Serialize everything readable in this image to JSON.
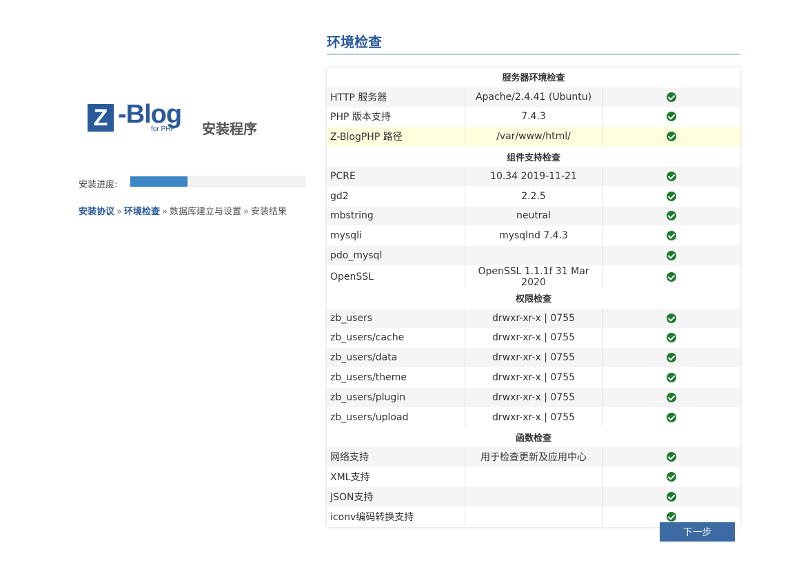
{
  "logo": {
    "z": "Z",
    "word": "-Blog",
    "sub": "for PHP",
    "title": "安装程序"
  },
  "progress": {
    "label": "安装进度:",
    "value": 0.33
  },
  "steps": [
    {
      "label": "安装协议",
      "done": true
    },
    {
      "label": "环境检查",
      "done": true
    },
    {
      "label": "数据库建立与设置",
      "done": false
    },
    {
      "label": "安装结果",
      "done": false
    }
  ],
  "step_separator": "»",
  "page_title": "环境检查",
  "sections": [
    {
      "title": "服务器环境检查",
      "rows": [
        {
          "name": "HTTP 服务器",
          "value": "Apache/2.4.41 (Ubuntu)",
          "status": "ok"
        },
        {
          "name": "PHP 版本支持",
          "value": "7.4.3",
          "status": "ok"
        },
        {
          "name": "Z-BlogPHP 路径",
          "value": "/var/www/html/",
          "status": "ok",
          "highlight": true
        }
      ]
    },
    {
      "title": "组件支持检查",
      "rows": [
        {
          "name": "PCRE",
          "value": "10.34 2019-11-21",
          "status": "ok"
        },
        {
          "name": "gd2",
          "value": "2.2.5",
          "status": "ok"
        },
        {
          "name": "mbstring",
          "value": "neutral",
          "status": "ok"
        },
        {
          "name": "mysqli",
          "value": "mysqlnd 7.4.3",
          "status": "ok"
        },
        {
          "name": "pdo_mysql",
          "value": "",
          "status": "ok"
        },
        {
          "name": "OpenSSL",
          "value": "OpenSSL 1.1.1f 31 Mar 2020",
          "status": "ok"
        }
      ]
    },
    {
      "title": "权限检查",
      "rows": [
        {
          "name": "zb_users",
          "value": "drwxr-xr-x | 0755",
          "status": "ok"
        },
        {
          "name": "zb_users/cache",
          "value": "drwxr-xr-x | 0755",
          "status": "ok"
        },
        {
          "name": "zb_users/data",
          "value": "drwxr-xr-x | 0755",
          "status": "ok"
        },
        {
          "name": "zb_users/theme",
          "value": "drwxr-xr-x | 0755",
          "status": "ok"
        },
        {
          "name": "zb_users/plugin",
          "value": "drwxr-xr-x | 0755",
          "status": "ok"
        },
        {
          "name": "zb_users/upload",
          "value": "drwxr-xr-x | 0755",
          "status": "ok"
        }
      ]
    },
    {
      "title": "函数检查",
      "rows": [
        {
          "name": "网络支持",
          "value": "用于检查更新及应用中心",
          "status": "ok"
        },
        {
          "name": "XML支持",
          "value": "",
          "status": "ok"
        },
        {
          "name": "JSON支持",
          "value": "",
          "status": "ok"
        },
        {
          "name": "iconv编码转换支持",
          "value": "",
          "status": "ok"
        }
      ]
    }
  ],
  "status_icon": "check-circle-icon",
  "colors": {
    "accent": "#2a5a9a",
    "progress": "#3d86c6",
    "ok": "#1e7a2e",
    "button": "#3d6aa3",
    "highlight": "#ffffdd"
  },
  "next_button": "下一步"
}
